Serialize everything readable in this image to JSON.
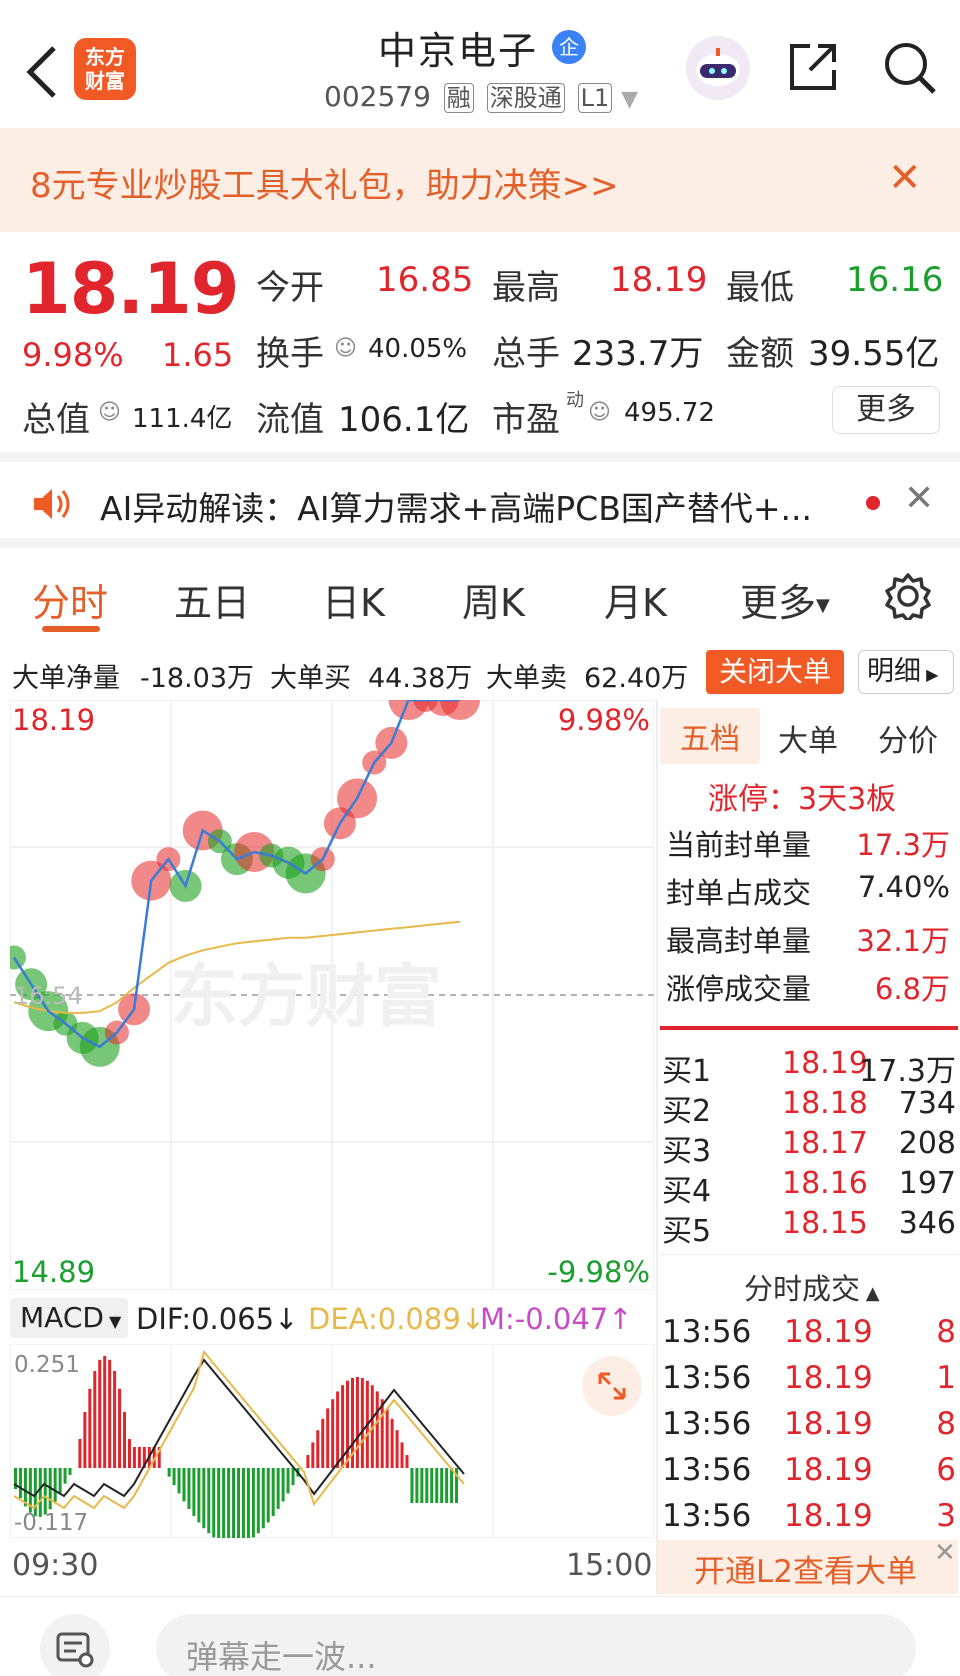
{
  "header": {
    "logo_line1": "东方",
    "logo_line2": "财富",
    "title": "中京电子",
    "title_badge": "企",
    "code": "002579",
    "tags": [
      "融",
      "深股通",
      "L1"
    ]
  },
  "banner": {
    "text": "8元专业炒股工具大礼包，助力决策>>"
  },
  "quote": {
    "price": "18.19",
    "change_pct": "9.98%",
    "change": "1.65",
    "open_label": "今开",
    "open": "16.85",
    "high_label": "最高",
    "high": "18.19",
    "low_label": "最低",
    "low": "16.16",
    "turnover_label": "换手",
    "turnover": "40.05%",
    "volume_label": "总手",
    "volume": "233.7万",
    "amount_label": "金额",
    "amount": "39.55亿",
    "mktcap_label": "总值",
    "mktcap": "111.4亿",
    "float_label": "流值",
    "float": "106.1亿",
    "pe_label": "市盈",
    "pe_sup": "动",
    "pe": "495.72",
    "more": "更多"
  },
  "ai": {
    "text": "AI异动解读：AI算力需求+高端PCB国产替代+..."
  },
  "tabs": [
    "分时",
    "五日",
    "日K",
    "周K",
    "月K",
    "更多"
  ],
  "bigorder": {
    "net_label": "大单净量",
    "net": "-18.03万",
    "buy_label": "大单买",
    "buy": "44.38万",
    "sell_label": "大单卖",
    "sell": "62.40万",
    "close_btn": "关闭大单",
    "detail": "明细"
  },
  "chart": {
    "top_price": "18.19",
    "top_pct": "9.98%",
    "bottom_price": "14.89",
    "bottom_pct": "-9.98%",
    "mid_price": "16.54",
    "watermark": "东方财富",
    "start_time": "09:30",
    "end_time": "15:00"
  },
  "macd": {
    "selector": "MACD",
    "dif": "DIF:0.065",
    "dea": "DEA:0.089",
    "m": "M:-0.047",
    "top": "0.251",
    "bottom": "-0.117"
  },
  "panel": {
    "tabs": [
      "五档",
      "大单",
      "分价"
    ],
    "limit_up": "涨停：3天3板",
    "stats": [
      {
        "label": "当前封单量",
        "value": "17.3万",
        "red": true
      },
      {
        "label": "封单占成交",
        "value": "7.40%",
        "red": false
      },
      {
        "label": "最高封单量",
        "value": "32.1万",
        "red": true
      },
      {
        "label": "涨停成交量",
        "value": "6.8万",
        "red": true
      }
    ],
    "book": [
      {
        "label": "买1",
        "price": "18.19",
        "vol": "17.3万"
      },
      {
        "label": "买2",
        "price": "18.18",
        "vol": "734"
      },
      {
        "label": "买3",
        "price": "18.17",
        "vol": "208"
      },
      {
        "label": "买4",
        "price": "18.16",
        "vol": "197"
      },
      {
        "label": "买5",
        "price": "18.15",
        "vol": "346"
      }
    ],
    "ticks_header": "分时成交",
    "ticks": [
      {
        "time": "13:56",
        "price": "18.19",
        "vol": "8"
      },
      {
        "time": "13:56",
        "price": "18.19",
        "vol": "1"
      },
      {
        "time": "13:56",
        "price": "18.19",
        "vol": "8"
      },
      {
        "time": "13:56",
        "price": "18.19",
        "vol": "6"
      },
      {
        "time": "13:56",
        "price": "18.19",
        "vol": "3"
      }
    ],
    "l2": "开通L2查看大单"
  },
  "bottom": {
    "placeholder": "弹幕走一波..."
  },
  "colors": {
    "up": "#e0262c",
    "down": "#1a9e2e",
    "accent": "#f15a24",
    "avg": "#e8b84a"
  },
  "chart_data": {
    "type": "line",
    "x_range": [
      "09:30",
      "15:00"
    ],
    "ylim": [
      14.89,
      18.19
    ],
    "prev_close": 16.54,
    "price": [
      16.75,
      16.6,
      16.45,
      16.38,
      16.3,
      16.25,
      16.33,
      16.46,
      17.18,
      17.3,
      17.15,
      17.46,
      17.4,
      17.3,
      17.34,
      17.32,
      17.28,
      17.22,
      17.3,
      17.5,
      17.64,
      17.84,
      17.95,
      18.19,
      18.19,
      18.19,
      18.19
    ],
    "avg": [
      16.5,
      16.47,
      16.45,
      16.44,
      16.44,
      16.45,
      16.5,
      16.58,
      16.65,
      16.72,
      16.76,
      16.79,
      16.81,
      16.83,
      16.84,
      16.85,
      16.86,
      16.86,
      16.87,
      16.88,
      16.89,
      16.9,
      16.91,
      16.92,
      16.93,
      16.94,
      16.95
    ]
  }
}
